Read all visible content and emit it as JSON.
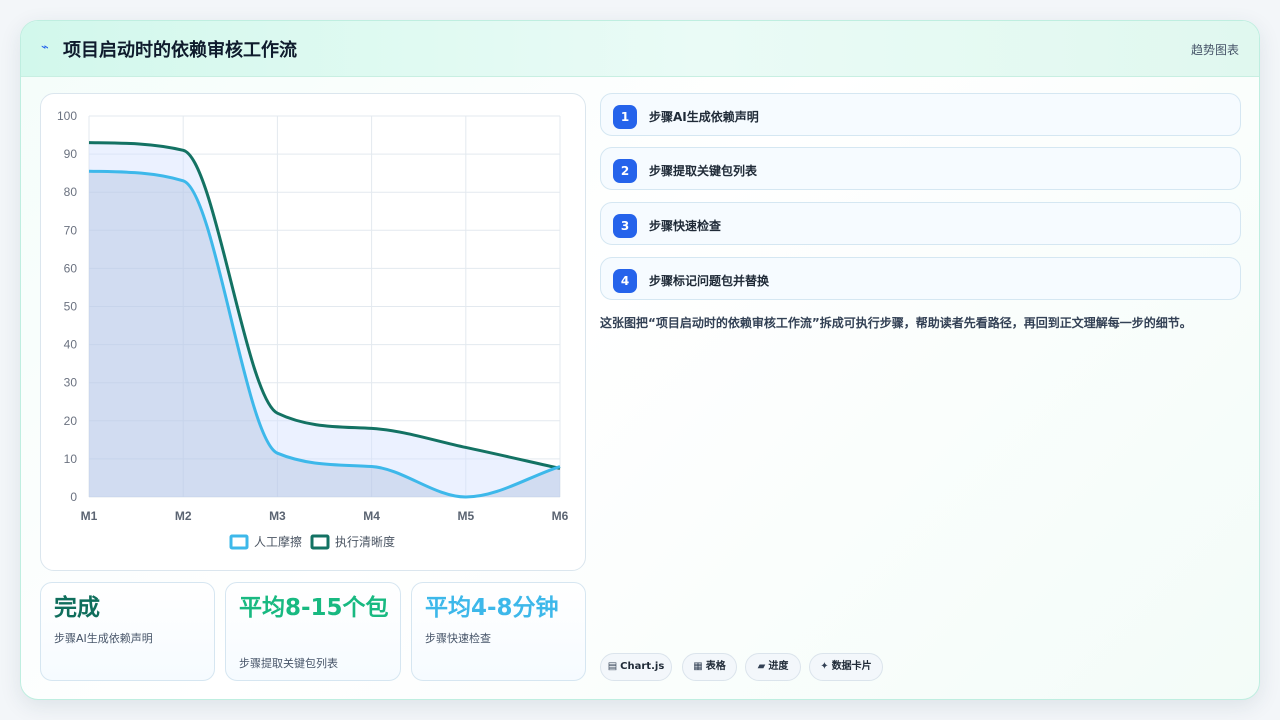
{
  "header": {
    "icon": "pulse-icon",
    "title": "项目启动时的依赖审核工作流",
    "tag": "趋势图表"
  },
  "chart_data": {
    "type": "line",
    "categories": [
      "M1",
      "M2",
      "M3",
      "M4",
      "M5",
      "M6"
    ],
    "ylim": [
      0,
      100
    ],
    "yticks": [
      0,
      10,
      20,
      30,
      40,
      50,
      60,
      70,
      80,
      90,
      100
    ],
    "grid": true,
    "legend": "bottom",
    "series": [
      {
        "name": "人工摩擦",
        "values": [
          85.5,
          83,
          11.5,
          8,
          0,
          8
        ],
        "color": "#3db8ea",
        "fill": "rgba(160,180,215,0.35)"
      },
      {
        "name": "执行清晰度",
        "values": [
          93,
          91,
          22,
          18,
          13,
          7.5
        ],
        "color": "#137263",
        "fill": "rgba(210,225,255,0.45)"
      }
    ]
  },
  "stats": [
    {
      "value": "完成",
      "label": "步骤AI生成依赖声明",
      "color": "#0f6e5c"
    },
    {
      "value": "平均8-15个包",
      "label": "步骤提取关键包列表",
      "color": "#18b981"
    },
    {
      "value": "平均4-8分钟",
      "label": "步骤快速检查",
      "color": "#3db8ea"
    }
  ],
  "steps": [
    {
      "num": "1",
      "text": "步骤AI生成依赖声明"
    },
    {
      "num": "2",
      "text": "步骤提取关键包列表"
    },
    {
      "num": "3",
      "text": "步骤快速检查"
    },
    {
      "num": "4",
      "text": "步骤标记问题包并替换"
    }
  ],
  "description": "这张图把“项目启动时的依赖审核工作流”拆成可执行步骤，帮助读者先看路径，再回到正文理解每一步的细节。",
  "chips": [
    {
      "icon": "▤",
      "label": "Chart.js"
    },
    {
      "icon": "▦",
      "label": "表格"
    },
    {
      "icon": "▰",
      "label": "进度"
    },
    {
      "icon": "✦",
      "label": "数据卡片"
    }
  ]
}
